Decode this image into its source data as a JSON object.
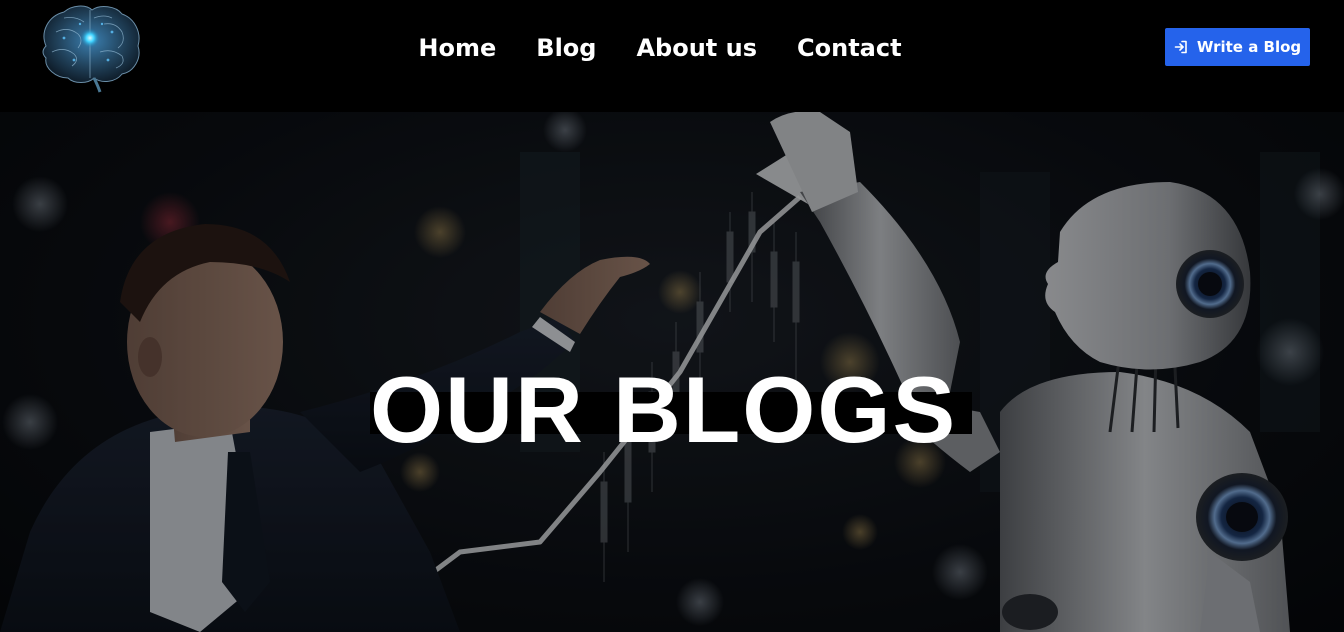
{
  "nav": {
    "logo": {
      "icon": "brain-circuit-icon"
    },
    "links": [
      "Home",
      "Blog",
      "About us",
      "Contact"
    ],
    "cta": {
      "label": "Write a Blog",
      "icon": "sign-in-arrow-icon",
      "color": "#2563eb"
    }
  },
  "hero": {
    "title": "OUR BLOGS",
    "image": "businessman-and-humanoid-robot-reaching-toward-rising-chart-arrow"
  },
  "colors": {
    "navbar_bg": "#000000",
    "accent": "#2563eb",
    "text": "#ffffff"
  }
}
